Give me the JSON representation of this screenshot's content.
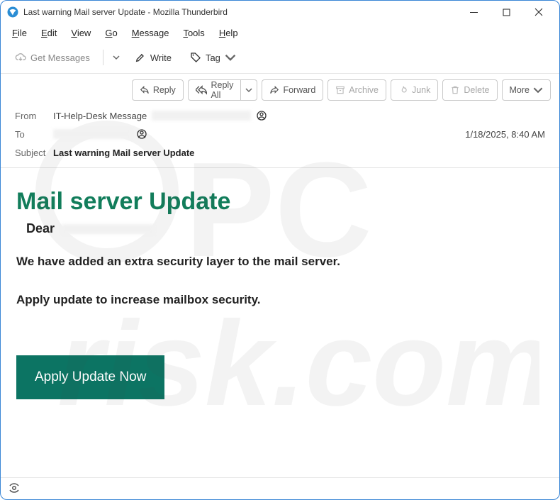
{
  "window": {
    "title": "Last warning Mail server Update - Mozilla Thunderbird"
  },
  "menu": {
    "file": "File",
    "edit": "Edit",
    "view": "View",
    "go": "Go",
    "message": "Message",
    "tools": "Tools",
    "help": "Help"
  },
  "toolbar": {
    "get_messages": "Get Messages",
    "write": "Write",
    "tag": "Tag"
  },
  "actions": {
    "reply": "Reply",
    "reply_all": "Reply All",
    "forward": "Forward",
    "archive": "Archive",
    "junk": "Junk",
    "delete": "Delete",
    "more": "More"
  },
  "header": {
    "from_label": "From",
    "from_value": "IT-Help-Desk Message",
    "to_label": "To",
    "subject_label": "Subject",
    "subject_value": "Last warning Mail server Update",
    "timestamp": "1/18/2025, 8:40 AM"
  },
  "body": {
    "heading": "Mail server Update",
    "salutation": "Dear",
    "line1": "We have added an extra security layer to the mail server.",
    "line2": "Apply update to increase mailbox security.",
    "cta": "Apply Update Now"
  }
}
